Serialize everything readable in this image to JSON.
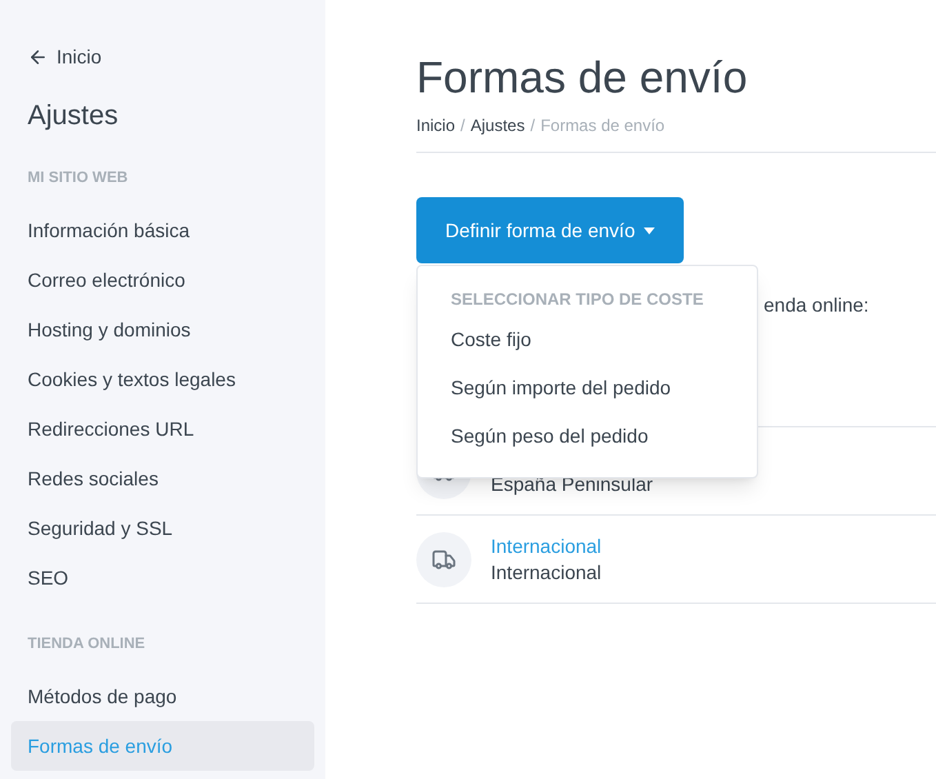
{
  "sidebar": {
    "back_link": "Inicio",
    "title": "Ajustes",
    "sections": [
      {
        "heading": "MI SITIO WEB",
        "items": [
          {
            "label": "Información básica",
            "selected": false
          },
          {
            "label": "Correo electrónico",
            "selected": false
          },
          {
            "label": "Hosting y dominios",
            "selected": false
          },
          {
            "label": "Cookies y textos legales",
            "selected": false
          },
          {
            "label": "Redirecciones URL",
            "selected": false
          },
          {
            "label": "Redes sociales",
            "selected": false
          },
          {
            "label": "Seguridad y SSL",
            "selected": false
          },
          {
            "label": "SEO",
            "selected": false
          }
        ]
      },
      {
        "heading": "TIENDA ONLINE",
        "items": [
          {
            "label": "Métodos de pago",
            "selected": false
          },
          {
            "label": "Formas de envío",
            "selected": true
          }
        ]
      }
    ]
  },
  "page": {
    "title": "Formas de envío",
    "breadcrumb_separator": "/",
    "breadcrumb": [
      {
        "label": "Inicio",
        "link": true
      },
      {
        "label": "Ajustes",
        "link": true
      },
      {
        "label": "Formas de envío",
        "link": false
      }
    ],
    "button": "Definir forma de envío",
    "dropdown": {
      "header": "SELECCIONAR TIPO DE COSTE",
      "items": [
        "Coste fijo",
        "Según importe del pedido",
        "Según peso del pedido"
      ]
    },
    "intro_text": "enda online:",
    "shipping_methods": [
      {
        "subtitle": "España Peninsular"
      },
      {
        "title": "Internacional",
        "subtitle": "Internacional"
      }
    ]
  }
}
